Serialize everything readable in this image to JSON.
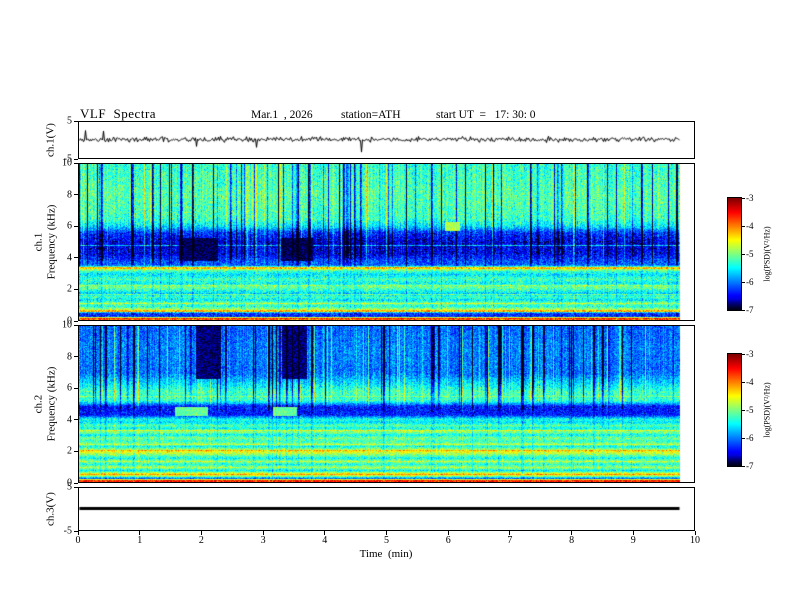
{
  "header": {
    "title": "VLF  Spectra",
    "date": "Mar.1  , 2026",
    "station": "station=ATH",
    "start_ut": "start UT  =   17: 30: 0"
  },
  "x_axis": {
    "label": "Time  (min)",
    "ticks": [
      0,
      1,
      2,
      3,
      4,
      5,
      6,
      7,
      8,
      9,
      10
    ],
    "range": [
      0,
      10
    ],
    "data_tmax": 9.78
  },
  "chart_data": [
    {
      "id": "ch1_waveform",
      "type": "line",
      "ylabel": "ch.1(V)",
      "ylim": [
        -5,
        5
      ],
      "yticks": [
        5,
        -5
      ],
      "x_range": [
        0,
        10
      ],
      "tmax": 9.78,
      "signal": {
        "baseline": 0,
        "noise_std": 0.42,
        "spike_prob": 0.015,
        "spike_max": 3.8,
        "spike_neg_frac": 0.72,
        "seed": 77,
        "line_width": 1
      },
      "description": "broadband noise band of ~±0.7 V around 0 with impulsive spikes, mostly downward to -4 V"
    },
    {
      "id": "ch1_spectrogram",
      "type": "heatmap",
      "ylabel_line1": "ch.1",
      "ylabel_line2": "Frequency  (kHz)",
      "ylim": [
        0,
        10
      ],
      "yticks": [
        10,
        8,
        6,
        4,
        2,
        0
      ],
      "x_range": [
        0,
        10
      ],
      "tmax": 9.78,
      "colorbar": {
        "label": "log(PSD)(V²/Hz)",
        "ticks": [
          -3,
          -4,
          -5,
          -6,
          -7
        ],
        "min": -7,
        "max": -3
      },
      "seed": 1234,
      "noise": 0.55,
      "profile": [
        [
          0,
          -3.9
        ],
        [
          0.1,
          -4.0
        ],
        [
          0.2,
          -6.4
        ],
        [
          0.42,
          -6.2
        ],
        [
          0.52,
          -4.5
        ],
        [
          0.68,
          -4.9
        ],
        [
          0.85,
          -5.4
        ],
        [
          1.05,
          -5.0
        ],
        [
          1.25,
          -5.6
        ],
        [
          1.45,
          -5.2
        ],
        [
          1.65,
          -5.7
        ],
        [
          1.9,
          -5.3
        ],
        [
          2.1,
          -5.0
        ],
        [
          2.35,
          -5.5
        ],
        [
          2.6,
          -5.2
        ],
        [
          2.9,
          -5.6
        ],
        [
          3.1,
          -5.3
        ],
        [
          3.32,
          -4.5
        ],
        [
          3.5,
          -6.1
        ],
        [
          3.8,
          -6.2
        ],
        [
          4.2,
          -6.5
        ],
        [
          5.0,
          -6.55
        ],
        [
          5.6,
          -6.3
        ],
        [
          6.0,
          -5.6
        ],
        [
          6.5,
          -5.25
        ],
        [
          8.0,
          -5.15
        ],
        [
          10,
          -5.3
        ]
      ],
      "lines": [
        {
          "f": 3.32,
          "w": 0.12,
          "level": -4.25
        },
        {
          "f": 2.2,
          "w": 0.07,
          "level": -4.9
        },
        {
          "f": 1.05,
          "w": 0.07,
          "level": -4.7
        },
        {
          "f": 0.55,
          "w": 0.08,
          "level": -4.2
        },
        {
          "f": 0.06,
          "w": 0.1,
          "level": -3.6
        },
        {
          "f": 4.75,
          "w": 0.06,
          "level": -5.7
        },
        {
          "f": 2.8,
          "w": 0.05,
          "level": -5.0
        },
        {
          "f": 1.6,
          "w": 0.05,
          "level": -5.05
        }
      ],
      "patches": [
        {
          "t0": 1.62,
          "t1": 2.25,
          "f0": 3.75,
          "f1": 5.25,
          "level": -6.85,
          "mode": "dark"
        },
        {
          "t0": 3.28,
          "t1": 3.8,
          "f0": 3.75,
          "f1": 5.25,
          "level": -6.85,
          "mode": "dark"
        },
        {
          "t0": 5.95,
          "t1": 6.2,
          "f0": 5.7,
          "f1": 6.3,
          "level": -4.8,
          "mode": "bright"
        }
      ],
      "streaks": {
        "dark_prob": 0.1,
        "dark_strength": 1.5,
        "bright_prob": 0.05,
        "bright_strength": 0.6,
        "fmin": 3.0
      }
    },
    {
      "id": "ch2_spectrogram",
      "type": "heatmap",
      "ylabel_line1": "ch.2",
      "ylabel_line2": "Frequency  (kHz)",
      "ylim": [
        0,
        10
      ],
      "yticks": [
        10,
        8,
        6,
        4,
        2,
        0
      ],
      "x_range": [
        0,
        10
      ],
      "tmax": 9.78,
      "colorbar": {
        "label": "log(PSD)(V²/Hz)",
        "ticks": [
          -3,
          -4,
          -5,
          -6,
          -7
        ],
        "min": -7,
        "max": -3
      },
      "seed": 9876,
      "noise": 0.5,
      "profile": [
        [
          0,
          -3.8
        ],
        [
          0.1,
          -4.0
        ],
        [
          0.2,
          -6.2
        ],
        [
          0.35,
          -4.8
        ],
        [
          0.5,
          -4.4
        ],
        [
          0.7,
          -5.6
        ],
        [
          0.9,
          -4.8
        ],
        [
          1.1,
          -5.4
        ],
        [
          1.3,
          -4.9
        ],
        [
          1.5,
          -5.5
        ],
        [
          1.7,
          -5.0
        ],
        [
          1.95,
          -4.5
        ],
        [
          2.1,
          -5.0
        ],
        [
          2.25,
          -5.5
        ],
        [
          2.4,
          -4.9
        ],
        [
          2.6,
          -5.3
        ],
        [
          2.8,
          -5.0
        ],
        [
          3.0,
          -5.5
        ],
        [
          3.2,
          -4.9
        ],
        [
          3.45,
          -5.5
        ],
        [
          3.6,
          -5.1
        ],
        [
          3.8,
          -5.6
        ],
        [
          4.0,
          -5.4
        ],
        [
          4.3,
          -6.4
        ],
        [
          4.85,
          -6.4
        ],
        [
          5.2,
          -5.3
        ],
        [
          5.8,
          -5.25
        ],
        [
          6.3,
          -5.6
        ],
        [
          7.0,
          -6.05
        ],
        [
          8.5,
          -6.0
        ],
        [
          10,
          -6.1
        ]
      ],
      "lines": [
        {
          "f": 0.05,
          "w": 0.1,
          "level": -3.6
        },
        {
          "f": 0.45,
          "w": 0.1,
          "level": -4.1
        },
        {
          "f": 2.0,
          "w": 0.1,
          "level": -4.2
        },
        {
          "f": 3.3,
          "w": 0.07,
          "level": -4.6
        },
        {
          "f": 1.3,
          "w": 0.06,
          "level": -4.7
        },
        {
          "f": 2.4,
          "w": 0.05,
          "level": -4.7
        },
        {
          "f": 5.5,
          "w": 0.08,
          "level": -5.0
        }
      ],
      "patches": [
        {
          "t0": 1.55,
          "t1": 2.1,
          "f0": 4.25,
          "f1": 4.8,
          "level": -5.1,
          "mode": "bright"
        },
        {
          "t0": 3.15,
          "t1": 3.55,
          "f0": 4.25,
          "f1": 4.8,
          "level": -5.1,
          "mode": "bright"
        },
        {
          "t0": 1.9,
          "t1": 2.3,
          "f0": 6.6,
          "f1": 10,
          "level": -6.8,
          "mode": "dark"
        },
        {
          "t0": 3.3,
          "t1": 3.7,
          "f0": 6.6,
          "f1": 10,
          "level": -6.8,
          "mode": "dark"
        }
      ],
      "streaks": {
        "dark_prob": 0.09,
        "dark_strength": 1.4,
        "bright_prob": 0.06,
        "bright_strength": 0.7,
        "fmin": 4.3
      }
    },
    {
      "id": "ch3_waveform",
      "type": "line",
      "ylabel": "ch.3(V)",
      "ylim": [
        -5,
        5
      ],
      "yticks": [
        5,
        -5
      ],
      "x_range": [
        0,
        10
      ],
      "tmax": 9.78,
      "signal": {
        "baseline": 0,
        "noise_std": 0,
        "spike_prob": 0,
        "spike_max": 0,
        "spike_neg_frac": 0,
        "seed": 1,
        "line_width": 3
      },
      "description": "flat thick line at 0 V"
    }
  ]
}
